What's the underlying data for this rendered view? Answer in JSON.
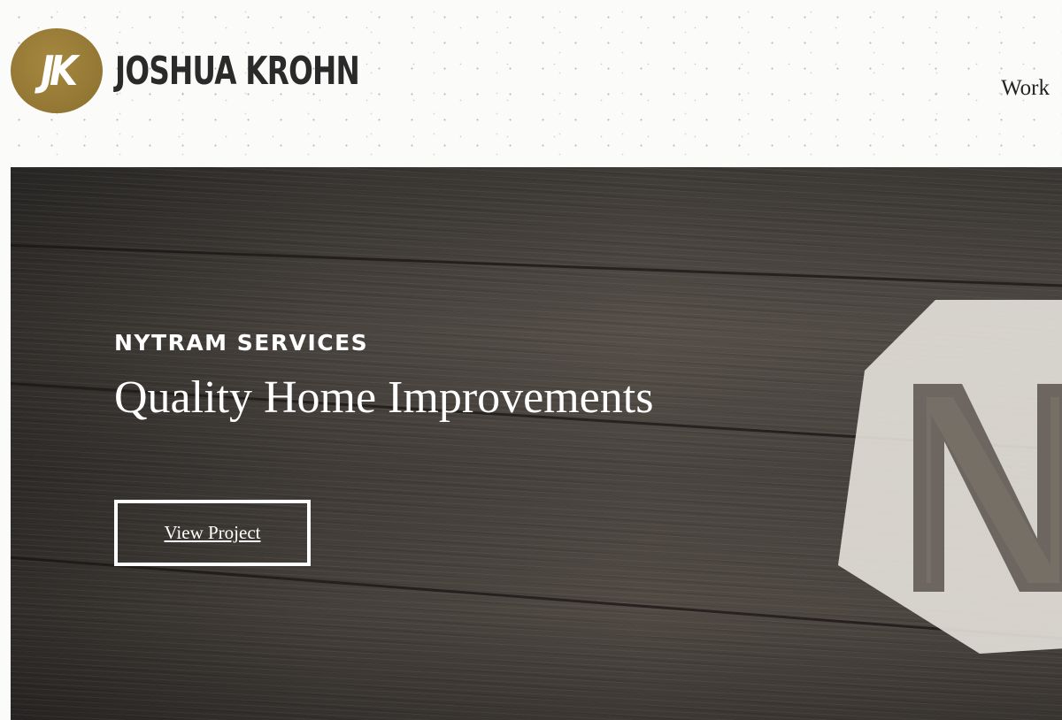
{
  "brand": {
    "monogram": "JK",
    "name": "JOSHUA KROHN",
    "accent_color": "#9a7d37"
  },
  "nav": {
    "items": [
      {
        "label": "Work"
      }
    ]
  },
  "hero": {
    "eyebrow": "NYTRAM SERVICES",
    "headline": "Quality Home Improvements",
    "cta_label": "View Project",
    "background": "weathered-wood-planks",
    "emblem_icon": "hexagon-n-logo-icon"
  }
}
